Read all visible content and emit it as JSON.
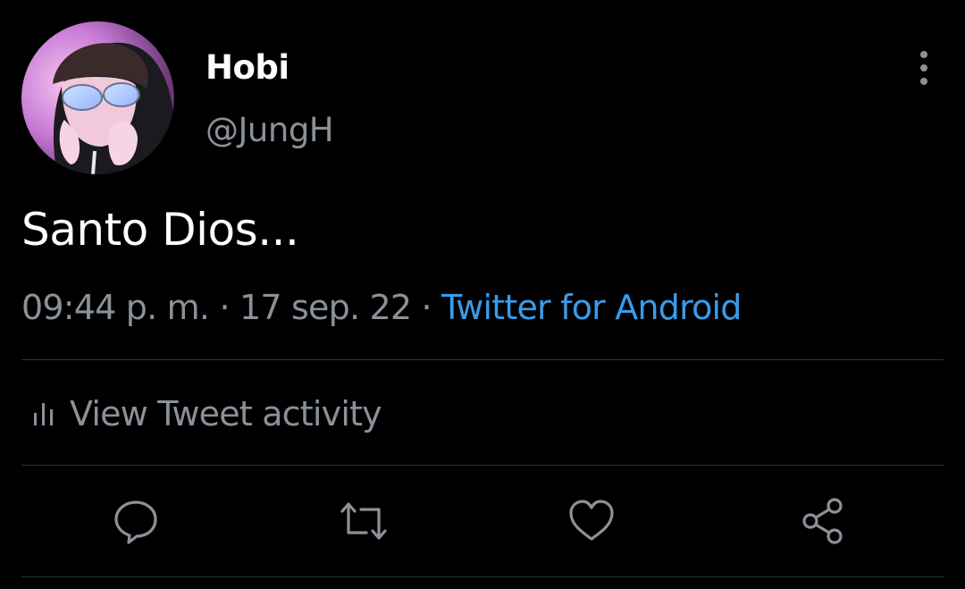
{
  "tweet": {
    "author_name": "Hobi",
    "author_handle": "@JungH",
    "text": "Santo Dios...",
    "time": "09:44 p. m.",
    "date": "17 sep. 22",
    "separator": "·",
    "source": "Twitter for Android"
  },
  "activity": {
    "label": "View Tweet activity",
    "icon": "bar-chart-icon"
  },
  "actions": [
    {
      "name": "reply",
      "icon": "comment-icon"
    },
    {
      "name": "retweet",
      "icon": "retweet-icon"
    },
    {
      "name": "like",
      "icon": "heart-icon"
    },
    {
      "name": "share",
      "icon": "share-icon"
    }
  ],
  "colors": {
    "background": "#000000",
    "primary_text": "#ffffff",
    "secondary_text": "#8b9199",
    "link": "#3b9ae8",
    "divider": "#2f3336"
  }
}
